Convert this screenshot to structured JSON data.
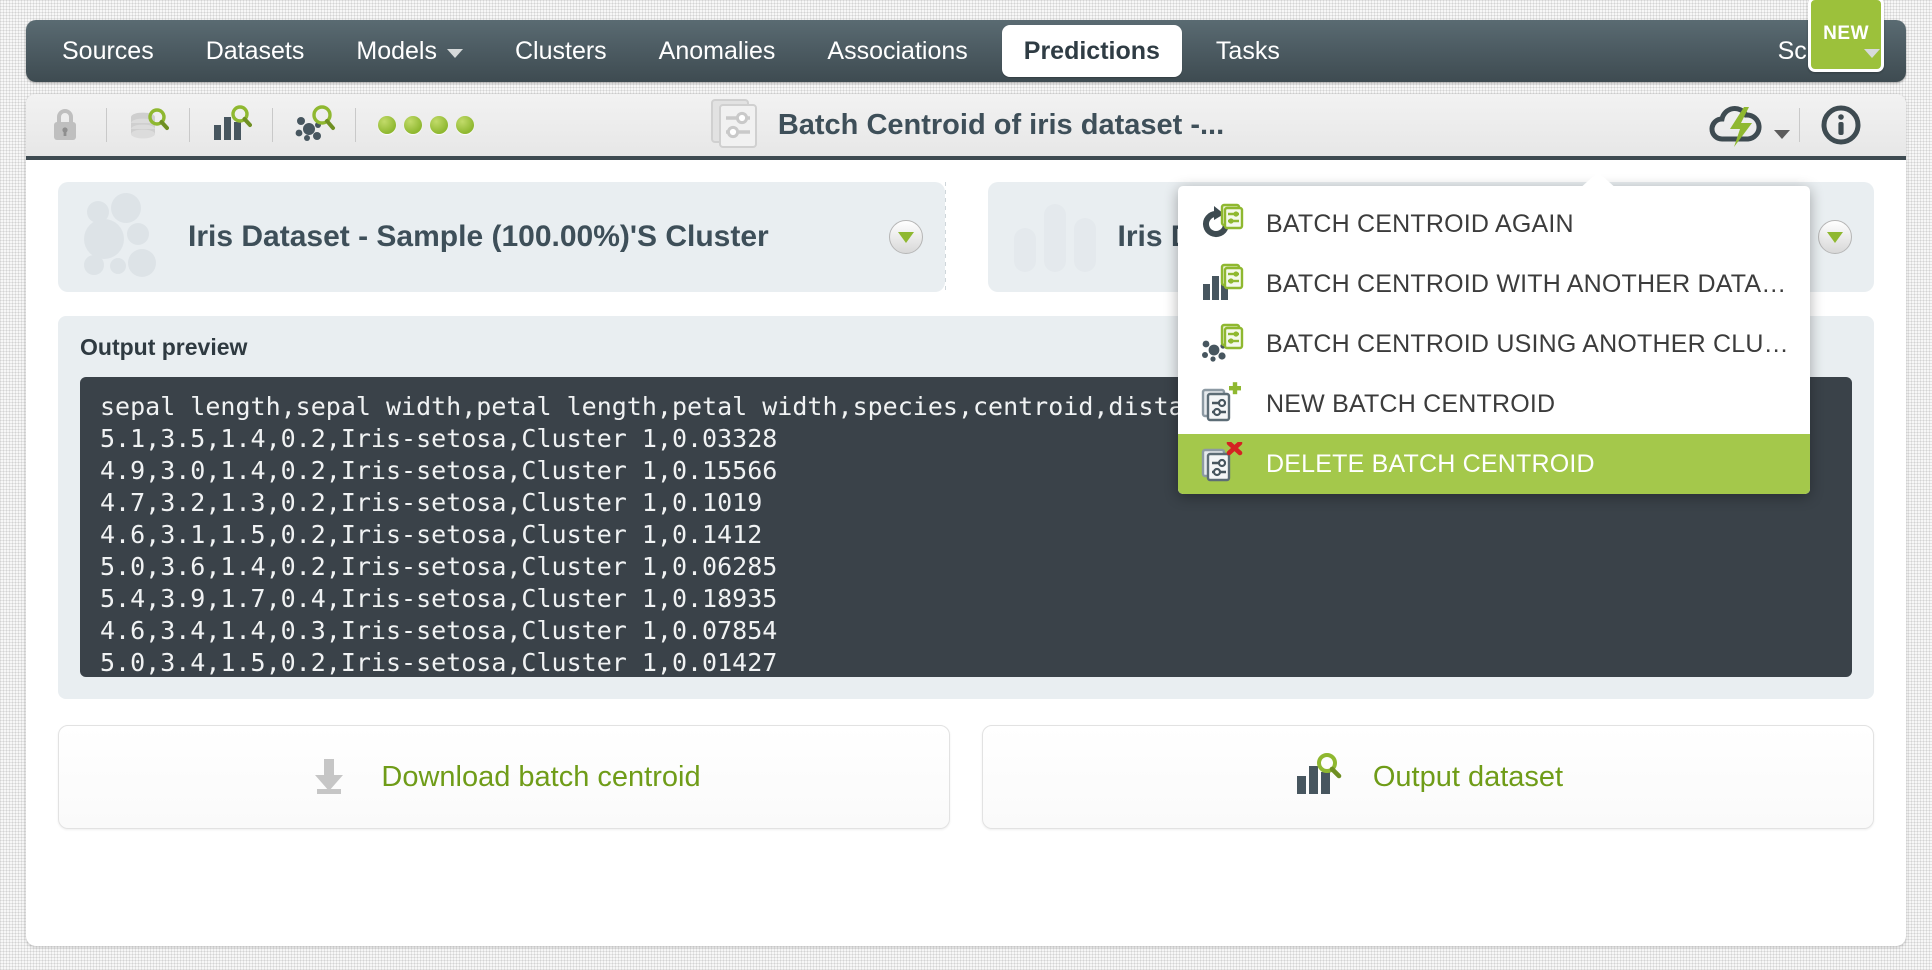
{
  "nav": {
    "items": [
      {
        "label": "Sources",
        "active": false,
        "caret": false
      },
      {
        "label": "Datasets",
        "active": false,
        "caret": false
      },
      {
        "label": "Models",
        "active": false,
        "caret": true
      },
      {
        "label": "Clusters",
        "active": false,
        "caret": false
      },
      {
        "label": "Anomalies",
        "active": false,
        "caret": false
      },
      {
        "label": "Associations",
        "active": false,
        "caret": false
      },
      {
        "label": "Predictions",
        "active": true,
        "caret": false
      },
      {
        "label": "Tasks",
        "active": false,
        "caret": false
      }
    ],
    "scripts_label": "Scripts",
    "new_badge": "NEW"
  },
  "toolbar": {
    "title": "Batch Centroid of iris dataset -...",
    "icons": [
      "lock-icon",
      "dataset-search-icon",
      "model-search-icon",
      "cluster-search-icon"
    ],
    "status_dots": 4,
    "actions_icon": "cloud-lightning-icon",
    "info_icon": "info-icon"
  },
  "cards": [
    {
      "title": "Iris Dataset - Sample (100.00%)'S Cluster",
      "icon": "cluster-icon"
    },
    {
      "title": "Iris D",
      "icon": "dataset-bars-icon"
    }
  ],
  "output": {
    "label": "Output preview",
    "text": "sepal length,sepal width,petal length,petal width,species,centroid,distance\n5.1,3.5,1.4,0.2,Iris-setosa,Cluster 1,0.03328\n4.9,3.0,1.4,0.2,Iris-setosa,Cluster 1,0.15566\n4.7,3.2,1.3,0.2,Iris-setosa,Cluster 1,0.1019\n4.6,3.1,1.5,0.2,Iris-setosa,Cluster 1,0.1412\n5.0,3.6,1.4,0.2,Iris-setosa,Cluster 1,0.06285\n5.4,3.9,1.7,0.4,Iris-setosa,Cluster 1,0.18935\n4.6,3.4,1.4,0.3,Iris-setosa,Cluster 1,0.07854\n5.0,3.4,1.5,0.2,Iris-setosa,Cluster 1,0.01427"
  },
  "buttons": {
    "download": {
      "label": "Download batch centroid",
      "icon": "download-icon"
    },
    "output_dataset": {
      "label": "Output dataset",
      "icon": "dataset-search-icon"
    }
  },
  "actions_menu": {
    "items": [
      {
        "label": "BATCH CENTROID AGAIN",
        "icon": "refresh-batch-icon",
        "selected": false
      },
      {
        "label": "BATCH CENTROID WITH ANOTHER DATASET",
        "icon": "dataset-batch-icon",
        "selected": false
      },
      {
        "label": "BATCH CENTROID USING ANOTHER CLUST...",
        "icon": "cluster-batch-icon",
        "selected": false
      },
      {
        "label": "NEW BATCH CENTROID",
        "icon": "new-batch-icon",
        "selected": false
      },
      {
        "label": "DELETE BATCH CENTROID",
        "icon": "delete-batch-icon",
        "selected": true
      }
    ]
  },
  "colors": {
    "accent_green": "#9cc13b",
    "nav_dark": "#3e4b51",
    "highlight_green": "#a4c84b",
    "link_green": "#6f9c18",
    "console_bg": "#3a4249"
  }
}
